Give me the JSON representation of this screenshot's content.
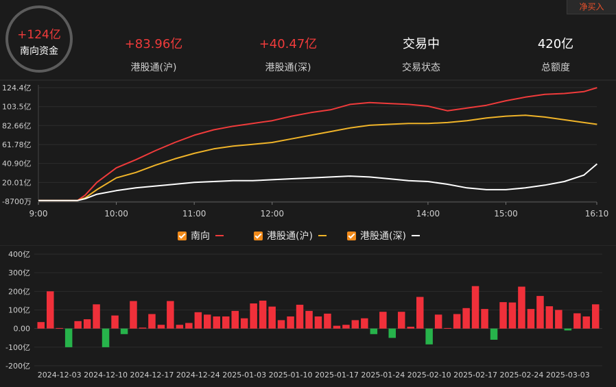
{
  "header": {
    "top_button": "净买入",
    "circle": {
      "value": "+124亿",
      "label": "南向资金"
    },
    "stats": [
      {
        "value": "+83.96亿",
        "label": "港股通(沪)",
        "color": "#f03b3b"
      },
      {
        "value": "+40.47亿",
        "label": "港股通(深)",
        "color": "#f03b3b"
      },
      {
        "value": "交易中",
        "label": "交易状态",
        "color": "#ffffff"
      },
      {
        "value": "420亿",
        "label": "总额度",
        "color": "#ffffff"
      }
    ]
  },
  "legend": [
    {
      "label": "南向",
      "color": "#f03b3b"
    },
    {
      "label": "港股通(沪)",
      "color": "#f0b429"
    },
    {
      "label": "港股通(深)",
      "color": "#ffffff"
    }
  ],
  "chart_data": [
    {
      "type": "line",
      "y_tick_labels": [
        "124.4亿",
        "103.5亿",
        "82.66亿",
        "61.78亿",
        "40.90亿",
        "20.01亿",
        "-8700万"
      ],
      "y_ticks": [
        124.4,
        103.5,
        82.66,
        61.78,
        40.9,
        20.01,
        -0.87
      ],
      "ylim": [
        -0.87,
        124.4
      ],
      "x_tick_labels": [
        "9:00",
        "10:00",
        "11:00",
        "12:00",
        "14:00",
        "15:00",
        "16:10"
      ],
      "x_ticks_hours": [
        9,
        10,
        11,
        12,
        14,
        15,
        16.1667
      ],
      "time_hours": [
        9.0,
        9.5,
        9.6,
        9.75,
        10.0,
        10.25,
        10.5,
        10.75,
        11.0,
        11.25,
        11.5,
        11.75,
        12.0,
        12.25,
        12.5,
        12.75,
        13.0,
        13.25,
        13.5,
        13.75,
        14.0,
        14.25,
        14.5,
        14.75,
        15.0,
        15.25,
        15.5,
        15.75,
        16.0,
        16.17
      ],
      "series": [
        {
          "name": "南向",
          "color": "#f03b3b",
          "values": [
            0,
            0,
            6,
            20,
            36,
            45,
            55,
            64,
            72,
            78,
            82,
            85,
            88,
            93,
            97,
            100,
            106,
            108,
            107,
            106,
            104,
            99,
            102,
            105,
            110,
            114,
            117,
            118,
            120,
            124.4
          ]
        },
        {
          "name": "港股通(沪)",
          "color": "#f0b429",
          "values": [
            0,
            0,
            3,
            12,
            25,
            31,
            39,
            46,
            52,
            57,
            60,
            62,
            64,
            68,
            72,
            76,
            80,
            83,
            84,
            85,
            85,
            86,
            88,
            91,
            93,
            94,
            92,
            89,
            86,
            84
          ]
        },
        {
          "name": "港股通(深)",
          "color": "#ffffff",
          "values": [
            0,
            0,
            2,
            7,
            11,
            14,
            16,
            18,
            20,
            21,
            22,
            22,
            23,
            24,
            25,
            26,
            27,
            26,
            24,
            22,
            21,
            18,
            14,
            12,
            12,
            14,
            17,
            21,
            28,
            40.5
          ]
        }
      ]
    },
    {
      "type": "bar",
      "y_tick_labels": [
        "400亿",
        "300亿",
        "200亿",
        "100亿",
        "0.00",
        "-100亿",
        "-200亿"
      ],
      "y_ticks": [
        400,
        300,
        200,
        100,
        0,
        -100,
        -200
      ],
      "ylim": [
        -200,
        400
      ],
      "x_tick_labels": [
        "2024-12-03",
        "2024-12-10",
        "2024-12-17",
        "2024-12-24",
        "2025-01-03",
        "2025-01-10",
        "2025-01-17",
        "2025-01-24",
        "2025-02-10",
        "2025-02-17",
        "2025-02-24",
        "2025-03-03"
      ],
      "x_tick_indices": [
        2,
        7,
        12,
        17,
        22,
        27,
        32,
        37,
        42,
        47,
        52,
        57
      ],
      "values": [
        35,
        200,
        3,
        -100,
        40,
        50,
        130,
        -100,
        70,
        -30,
        148,
        5,
        78,
        20,
        148,
        20,
        30,
        88,
        75,
        65,
        65,
        95,
        55,
        135,
        150,
        118,
        45,
        65,
        128,
        95,
        65,
        80,
        15,
        20,
        45,
        55,
        -30,
        90,
        -50,
        90,
        10,
        170,
        -85,
        75,
        3,
        78,
        110,
        228,
        105,
        -60,
        142,
        140,
        225,
        105,
        175,
        120,
        100,
        -10,
        82,
        65,
        130
      ]
    }
  ]
}
